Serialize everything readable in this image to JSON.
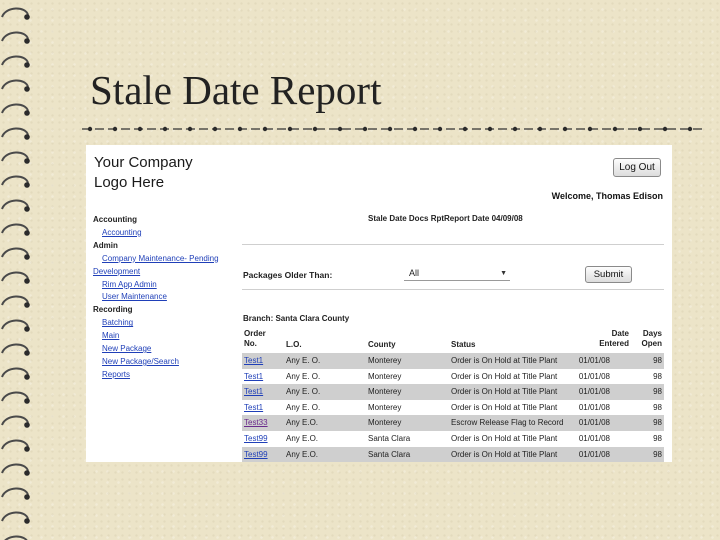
{
  "slide": {
    "title": "Stale Date Report"
  },
  "app": {
    "logo_text": "Your Company\nLogo Here",
    "logout_label": "Log Out",
    "welcome": "Welcome, Thomas Edison"
  },
  "nav": {
    "sections": [
      {
        "header": "Accounting",
        "links": [
          "Accounting"
        ]
      },
      {
        "header": "Admin",
        "links": [
          "Company Maintenance- Pending"
        ]
      },
      {
        "header": "",
        "links": [
          "Development"
        ],
        "flush": true
      },
      {
        "header": "",
        "links": [
          "Rim App Admin",
          "User Maintenance"
        ]
      },
      {
        "header": "Recording",
        "links": [
          "Batching",
          "Main",
          "New Package",
          "New Package/Search",
          "Reports"
        ]
      }
    ]
  },
  "report": {
    "header": "Stale Date Docs RptReport Date 04/09/08",
    "filter_label": "Packages Older Than:",
    "filter_value": "All",
    "submit_label": "Submit",
    "branch": "Branch: Santa Clara County",
    "columns": [
      "Order\nNo.",
      "L.O.",
      "County",
      "Status",
      "Date\nEntered",
      "Days\nOpen"
    ],
    "rows": [
      {
        "order": "Test1",
        "lo": "Any E. O.",
        "county": "Monterey",
        "status": "Order is On Hold at Title Plant",
        "date": "01/01/08",
        "days": "98",
        "visited": false
      },
      {
        "order": "Test1",
        "lo": "Any E. O.",
        "county": "Monterey",
        "status": "Order is On Hold at Title Plant",
        "date": "01/01/08",
        "days": "98",
        "visited": false
      },
      {
        "order": "Test1",
        "lo": "Any E. O.",
        "county": "Monterey",
        "status": "Order is On Hold at Title Plant",
        "date": "01/01/08",
        "days": "98",
        "visited": false
      },
      {
        "order": "Test1",
        "lo": "Any E. O.",
        "county": "Monterey",
        "status": "Order is On Hold at Title Plant",
        "date": "01/01/08",
        "days": "98",
        "visited": false
      },
      {
        "order": "Test33",
        "lo": "Any E.O.",
        "county": "Monterey",
        "status": "Escrow Release Flag to Record",
        "date": "01/01/08",
        "days": "98",
        "visited": true
      },
      {
        "order": "Test99",
        "lo": "Any E.O.",
        "county": "Santa Clara",
        "status": "Order is On Hold at Title Plant",
        "date": "01/01/08",
        "days": "98",
        "visited": false
      },
      {
        "order": "Test99",
        "lo": "Any E.O.",
        "county": "Santa Clara",
        "status": "Order is On Hold at Title Plant",
        "date": "01/01/08",
        "days": "98",
        "visited": false
      }
    ]
  }
}
